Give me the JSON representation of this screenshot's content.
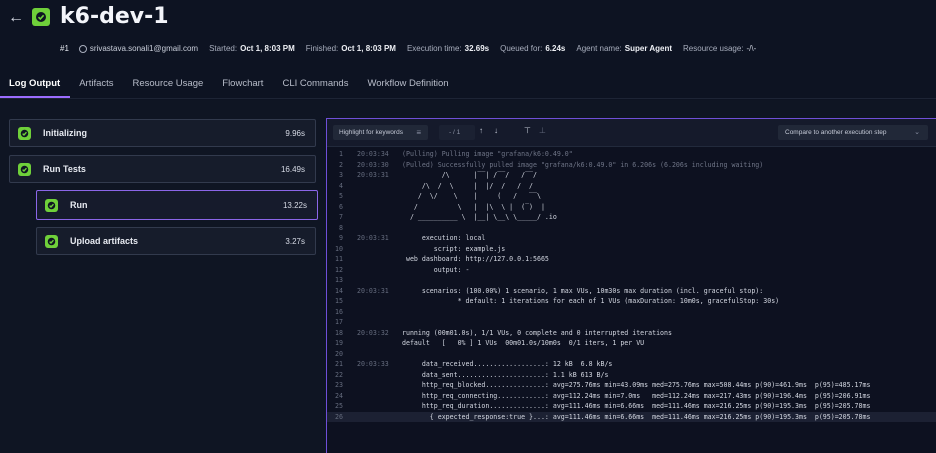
{
  "header": {
    "title": "k6-dev-1",
    "run_number": "#1",
    "user": "srivastava.sonali1@gmail.com",
    "started_label": "Started:",
    "started": "Oct 1, 8:03 PM",
    "finished_label": "Finished:",
    "finished": "Oct 1, 8:03 PM",
    "exec_label": "Execution time:",
    "exec_time": "32.69s",
    "queued_label": "Queued for:",
    "queued": "6.24s",
    "agent_label": "Agent name:",
    "agent": "Super Agent",
    "resource_label": "Resource usage:",
    "resource": "-/\\-"
  },
  "tabs": [
    {
      "label": "Log Output",
      "active": true
    },
    {
      "label": "Artifacts"
    },
    {
      "label": "Resource Usage"
    },
    {
      "label": "Flowchart"
    },
    {
      "label": "CLI Commands"
    },
    {
      "label": "Workflow Definition"
    }
  ],
  "steps": [
    {
      "label": "Initializing",
      "duration": "9.96s"
    },
    {
      "label": "Run Tests",
      "duration": "16.49s"
    },
    {
      "label": "Run",
      "duration": "13.22s",
      "selected": true
    },
    {
      "label": "Upload artifacts",
      "duration": "3.27s"
    }
  ],
  "toolbar": {
    "highlight": "Highlight for keywords",
    "search_count": "- / 1",
    "compare": "Compare to another execution step"
  },
  "colors": {
    "accent": "#9b6cff",
    "success": "#6fd03a"
  },
  "log_lines": [
    {
      "n": "1",
      "ts": "20:03:34",
      "text": "(Pulling) Pulling image \"grafana/k6:0.49.0\"",
      "dim": true
    },
    {
      "n": "2",
      "ts": "20:03:30",
      "text": "(Pulled) Successfully pulled image \"grafana/k6:0.49.0\" in 6.206s (6.206s including waiting)",
      "dim": true
    },
    {
      "n": "3",
      "ts": "20:03:31",
      "text": "          /\\      |‾‾| /‾‾/   /‾‾/"
    },
    {
      "n": "4",
      "ts": "",
      "text": "     /\\  /  \\     |  |/  /   /  /"
    },
    {
      "n": "5",
      "ts": "",
      "text": "    /  \\/    \\    |     (   /   ‾‾\\"
    },
    {
      "n": "6",
      "ts": "",
      "text": "   /          \\   |  |\\  \\ |  (‾)  |"
    },
    {
      "n": "7",
      "ts": "",
      "text": "  / __________ \\  |__| \\__\\ \\_____/ .io"
    },
    {
      "n": "8",
      "ts": "",
      "text": ""
    },
    {
      "n": "9",
      "ts": "20:03:31",
      "text": "     execution: local"
    },
    {
      "n": "10",
      "ts": "",
      "text": "        script: example.js"
    },
    {
      "n": "11",
      "ts": "",
      "text": " web dashboard: http://127.0.0.1:5665"
    },
    {
      "n": "12",
      "ts": "",
      "text": "        output: -"
    },
    {
      "n": "13",
      "ts": "",
      "text": ""
    },
    {
      "n": "14",
      "ts": "20:03:31",
      "text": "     scenarios: (100.00%) 1 scenario, 1 max VUs, 10m30s max duration (incl. graceful stop):"
    },
    {
      "n": "15",
      "ts": "",
      "text": "              * default: 1 iterations for each of 1 VUs (maxDuration: 10m0s, gracefulStop: 30s)"
    },
    {
      "n": "16",
      "ts": "",
      "text": ""
    },
    {
      "n": "17",
      "ts": "",
      "text": ""
    },
    {
      "n": "18",
      "ts": "20:03:32",
      "text": "running (00m01.0s), 1/1 VUs, 0 complete and 0 interrupted iterations"
    },
    {
      "n": "19",
      "ts": "",
      "text": "default   [   0% ] 1 VUs  00m01.0s/10m0s  0/1 iters, 1 per VU"
    },
    {
      "n": "20",
      "ts": "",
      "text": ""
    },
    {
      "n": "21",
      "ts": "20:03:33",
      "text": "     data_received..................: 12 kB  6.8 kB/s"
    },
    {
      "n": "22",
      "ts": "",
      "text": "     data_sent......................: 1.1 kB 613 B/s"
    },
    {
      "n": "23",
      "ts": "",
      "text": "     http_req_blocked...............: avg=275.76ms min=43.09ms med=275.76ms max=508.44ms p(90)=461.9ms  p(95)=485.17ms"
    },
    {
      "n": "24",
      "ts": "",
      "text": "     http_req_connecting............: avg=112.24ms min=7.0ms   med=112.24ms max=217.43ms p(90)=196.4ms  p(95)=206.91ms"
    },
    {
      "n": "25",
      "ts": "",
      "text": "     http_req_duration..............: avg=111.46ms min=6.66ms  med=111.46ms max=216.25ms p(90)=195.3ms  p(95)=205.78ms"
    },
    {
      "n": "26",
      "ts": "",
      "text": "       { expected_response:true }...: avg=111.46ms min=6.66ms  med=111.46ms max=216.25ms p(90)=195.3ms  p(95)=205.78ms"
    }
  ]
}
